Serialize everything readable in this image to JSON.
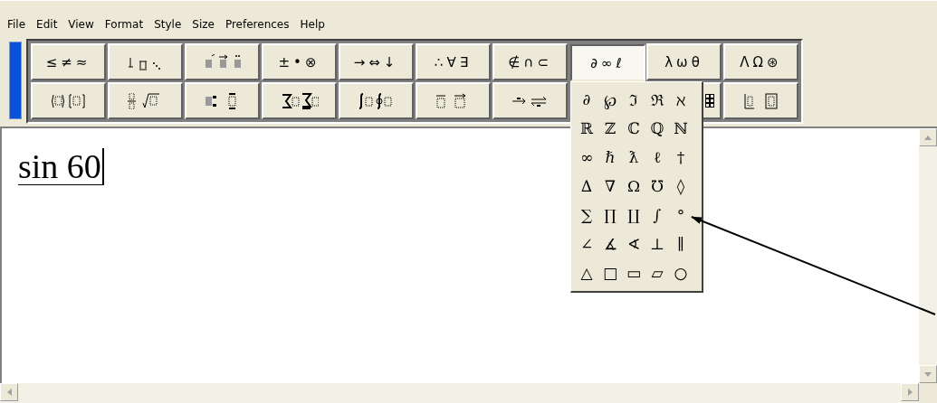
{
  "menu": [
    "File",
    "Edit",
    "View",
    "Format",
    "Style",
    "Size",
    "Preferences",
    "Help"
  ],
  "toolbar": {
    "rows": [
      [
        {
          "kind": "symbols",
          "label": "≤≠≈",
          "expanded": false
        },
        {
          "kind": "spaces",
          "expanded": false
        },
        {
          "kind": "embellishments",
          "expanded": false
        },
        {
          "kind": "symbols",
          "label": "±•⊗",
          "expanded": false
        },
        {
          "kind": "symbols",
          "label": "→⇔↓",
          "expanded": false
        },
        {
          "kind": "symbols",
          "label": "∴∀∃",
          "expanded": false
        },
        {
          "kind": "symbols",
          "label": "∉∩⊂",
          "expanded": false
        },
        {
          "kind": "symbols",
          "label": "∂∞ℓ",
          "expanded": true
        },
        {
          "kind": "symbols",
          "label": "λωθ",
          "expanded": false
        },
        {
          "kind": "symbols",
          "label": "ΛΩ⊛",
          "expanded": false
        }
      ],
      [
        {
          "kind": "fences",
          "expanded": false
        },
        {
          "kind": "fractions",
          "expanded": false
        },
        {
          "kind": "scripts",
          "expanded": false
        },
        {
          "kind": "sums",
          "expanded": false
        },
        {
          "kind": "integrals",
          "expanded": false
        },
        {
          "kind": "bars",
          "expanded": false
        },
        {
          "kind": "arrows",
          "expanded": false
        },
        {
          "kind": "grid",
          "expanded": false
        },
        {
          "kind": "matrices",
          "expanded": false
        }
      ]
    ]
  },
  "palette": [
    [
      "∂",
      "℘",
      "ℑ",
      "ℜ",
      "ℵ"
    ],
    [
      "ℝ",
      "ℤ",
      "ℂ",
      "ℚ",
      "ℕ"
    ],
    [
      "∞",
      "ℏ",
      "ƛ",
      "ℓ",
      "†"
    ],
    [
      "∆",
      "∇",
      "Ω",
      "℧",
      "◊"
    ],
    [
      "∑",
      "∏",
      "∐",
      "∫",
      "°"
    ],
    [
      "∠",
      "∡",
      "∢",
      "⊥",
      "∥"
    ],
    [
      "△",
      "□",
      "▭",
      "▱",
      "○"
    ]
  ],
  "editor": {
    "text": "sin 60"
  }
}
